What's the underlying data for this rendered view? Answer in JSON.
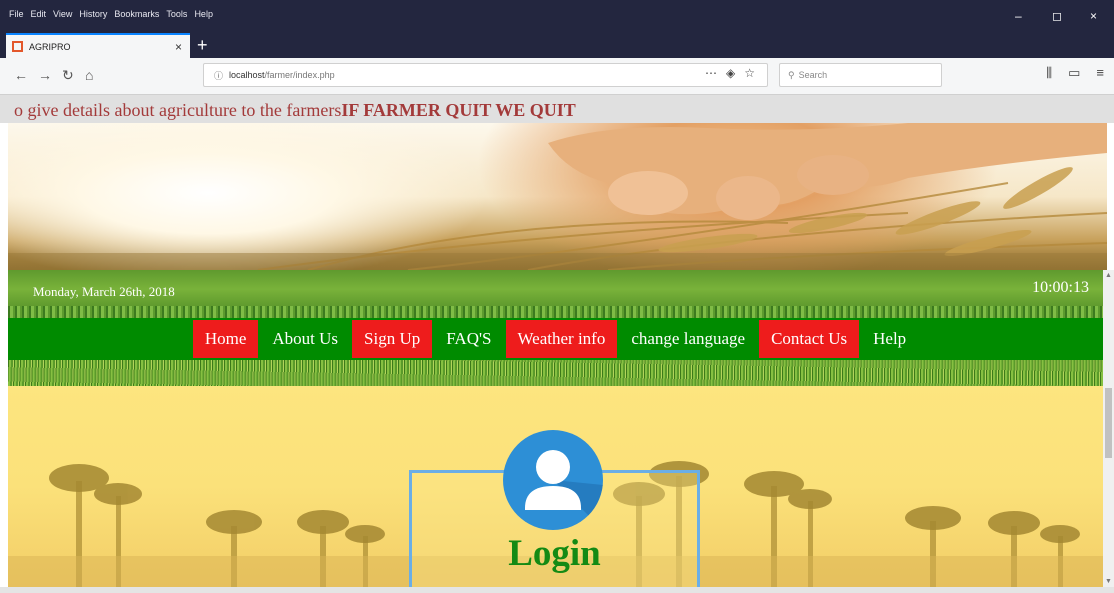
{
  "browser": {
    "menu": [
      "File",
      "Edit",
      "View",
      "History",
      "Bookmarks",
      "Tools",
      "Help"
    ],
    "tab_title": "AGRIPRO",
    "url_host": "localhost",
    "url_path": "/farmer/index.php",
    "search_placeholder": "Search",
    "window_controls": [
      "–",
      "◻",
      "×"
    ]
  },
  "page": {
    "marquee_text": "o give details about agriculture to the farmers",
    "marquee_bold": "IF FARMER QUIT WE QUIT",
    "date": "Monday, March 26th, 2018",
    "clock": "10:00:13",
    "nav": [
      {
        "label": "Home",
        "highlight": true
      },
      {
        "label": "About Us",
        "highlight": false
      },
      {
        "label": "Sign Up",
        "highlight": true
      },
      {
        "label": "FAQ'S",
        "highlight": false
      },
      {
        "label": "Weather info",
        "highlight": true
      },
      {
        "label": "change language",
        "highlight": false
      },
      {
        "label": "Contact Us",
        "highlight": true
      },
      {
        "label": "Help",
        "highlight": false
      }
    ],
    "login_title": "Login"
  },
  "colors": {
    "nav_bg": "#008b00",
    "nav_highlight": "#ee1c1c",
    "marquee_text": "#a33a3a",
    "login_title": "#148a14",
    "avatar_bg": "#2d8fd6"
  },
  "icons": {
    "back": "back-arrow-icon",
    "forward": "forward-arrow-icon",
    "reload": "reload-icon",
    "home": "home-icon",
    "avatar": "user-avatar-icon"
  }
}
